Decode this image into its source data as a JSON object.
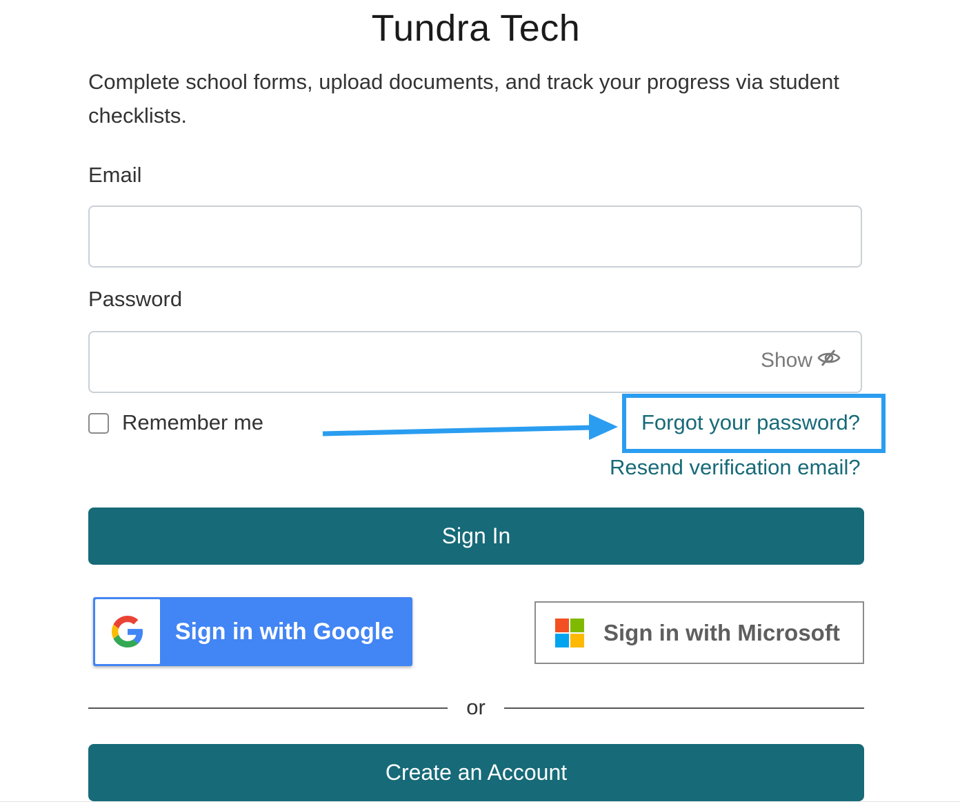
{
  "header": {
    "title": "Tundra Tech",
    "subtitle": "Complete school forms, upload documents, and track your progress via student checklists."
  },
  "form": {
    "email_label": "Email",
    "email_value": "",
    "password_label": "Password",
    "password_value": "",
    "show_label": "Show",
    "show_icon": "eye-slash-icon",
    "remember_label": "Remember me",
    "remember_checked": false,
    "forgot_link": "Forgot your password?",
    "resend_link": "Resend verification email?",
    "sign_in_label": "Sign In"
  },
  "sso": {
    "google_label": "Sign in with Google",
    "google_icon": "google-logo-icon",
    "microsoft_label": "Sign in with Microsoft",
    "microsoft_icon": "microsoft-logo-icon"
  },
  "divider": {
    "or_label": "or"
  },
  "create_account_label": "Create an Account",
  "colors": {
    "primary": "#176a78",
    "link": "#176a78",
    "annotation": "#2a9df0",
    "google_blue": "#4285f4"
  }
}
